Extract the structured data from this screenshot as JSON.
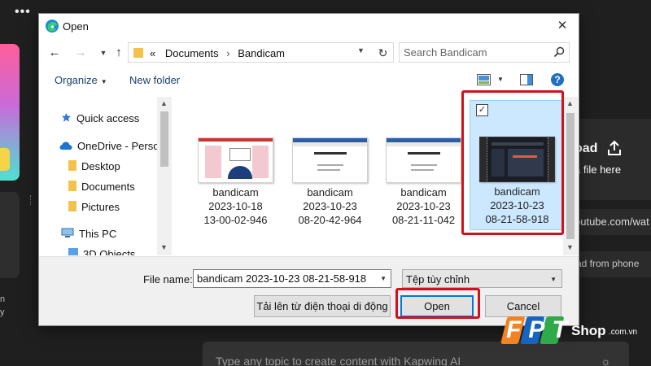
{
  "background": {
    "menu_dots": "•••",
    "upload_title": "oad",
    "upload_sub": "a file here",
    "youtube_text": "outube.com/wat",
    "phone_text": "ad from phone",
    "left_text_1": "n",
    "left_text_2": "y",
    "prompt_text": "Type any topic to create content with Kapwing AI"
  },
  "dialog": {
    "title": "Open",
    "close_glyph": "✕",
    "address": {
      "root_glyph": "«",
      "segments": [
        "Documents",
        "Bandicam"
      ]
    },
    "search": {
      "placeholder": "Search Bandicam"
    },
    "toolbar": {
      "organize": "Organize",
      "new_folder": "New folder",
      "help": "?"
    },
    "nav_items": [
      {
        "label": "Quick access",
        "icon": "star-icon"
      },
      {
        "label": "OneDrive - Person",
        "icon": "cloud-icon"
      },
      {
        "label": "Desktop",
        "icon": "folder-icon"
      },
      {
        "label": "Documents",
        "icon": "folder-icon"
      },
      {
        "label": "Pictures",
        "icon": "folder-icon"
      },
      {
        "label": "This PC",
        "icon": "computer-icon"
      },
      {
        "label": "3D Objects",
        "icon": "folder-icon"
      }
    ],
    "files": [
      {
        "name": "bandicam",
        "date": "2023-10-18",
        "time": "13-00-02-946",
        "selected": false
      },
      {
        "name": "bandicam",
        "date": "2023-10-23",
        "time": "08-20-42-964",
        "selected": false
      },
      {
        "name": "bandicam",
        "date": "2023-10-23",
        "time": "08-21-11-042",
        "selected": false
      },
      {
        "name": "bandicam",
        "date": "2023-10-23",
        "time": "08-21-58-918",
        "selected": true
      }
    ],
    "filename_label": "File name:",
    "filename_value": "bandicam 2023-10-23 08-21-58-918",
    "filetype": "Tệp tùy chỉnh",
    "buttons": {
      "upload": "Tải lên từ điện thoại di động",
      "open": "Open",
      "cancel": "Cancel"
    },
    "checkbox_glyph": "✓"
  },
  "watermark": {
    "brand": "FPT",
    "shop": "Shop",
    "domain": ".com.vn"
  },
  "colors": {
    "highlight": "#d2121a",
    "selection": "#cce8ff",
    "brand_orange": "#f58220",
    "brand_blue": "#1565c0",
    "brand_green": "#2eaa4a"
  }
}
